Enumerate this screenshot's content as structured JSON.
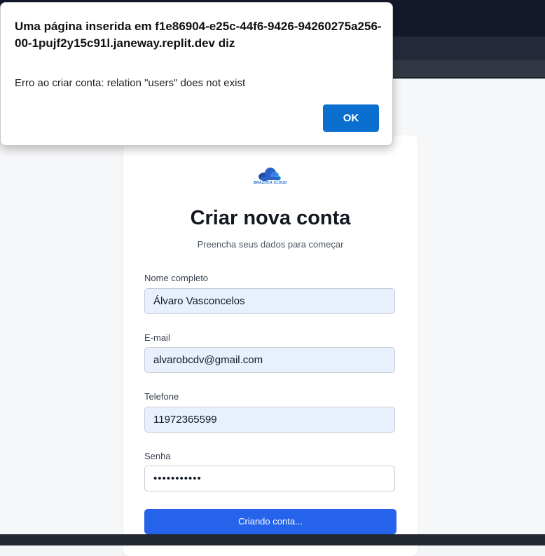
{
  "dialog": {
    "title": "Uma página inserida em f1e86904-e25c-44f6-9426-94260275a256-00-1pujf2y15c91l.janeway.replit.dev diz",
    "message": "Erro ao criar conta: relation \"users\" does not exist",
    "ok_label": "OK"
  },
  "logo": {
    "text": "BRAZUCA CLOUD",
    "icon": "cloud-icon"
  },
  "form": {
    "title": "Criar nova conta",
    "subtitle": "Preencha seus dados para começar",
    "name_label": "Nome completo",
    "name_value": "Álvaro Vasconcelos",
    "email_label": "E-mail",
    "email_value": "alvarobcdv@gmail.com",
    "phone_label": "Telefone",
    "phone_value": "11972365599",
    "password_label": "Senha",
    "password_value": "•••••••••••",
    "submit_label": "Criando conta..."
  },
  "colors": {
    "accent": "#2563eb",
    "dialog_button": "#0b6fd0",
    "autofill_bg": "#e8f0fe"
  }
}
